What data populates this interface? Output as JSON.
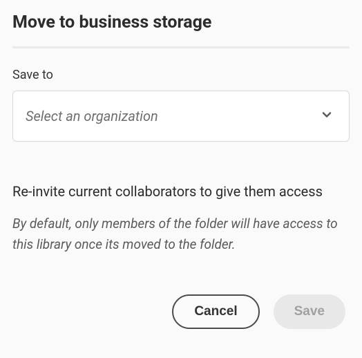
{
  "dialog": {
    "title": "Move to business storage",
    "saveTo": {
      "label": "Save to",
      "placeholder": "Select an organization"
    },
    "reinvite": {
      "heading": "Re-invite current collaborators to give them access",
      "description": "By default, only members of the folder will have access to this library once its moved to the folder."
    },
    "actions": {
      "cancel": "Cancel",
      "save": "Save"
    }
  }
}
